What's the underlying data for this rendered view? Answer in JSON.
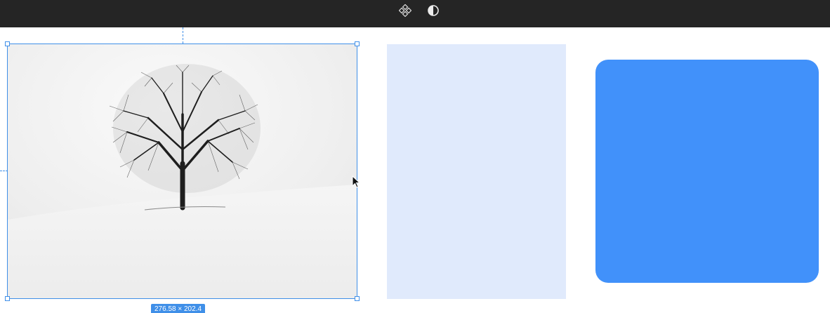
{
  "toolbar": {
    "icons": [
      "component-icon",
      "contrast-icon"
    ]
  },
  "canvas": {
    "selected_image": {
      "description_icon": "tree-image",
      "dimensions_label": "276.58 × 202.4"
    },
    "shapes": [
      {
        "name": "light-blue-rectangle",
        "color": "#e0eafc"
      },
      {
        "name": "blue-rounded-square",
        "color": "#4191fa"
      }
    ],
    "selection_color": "#3f8fe8"
  }
}
